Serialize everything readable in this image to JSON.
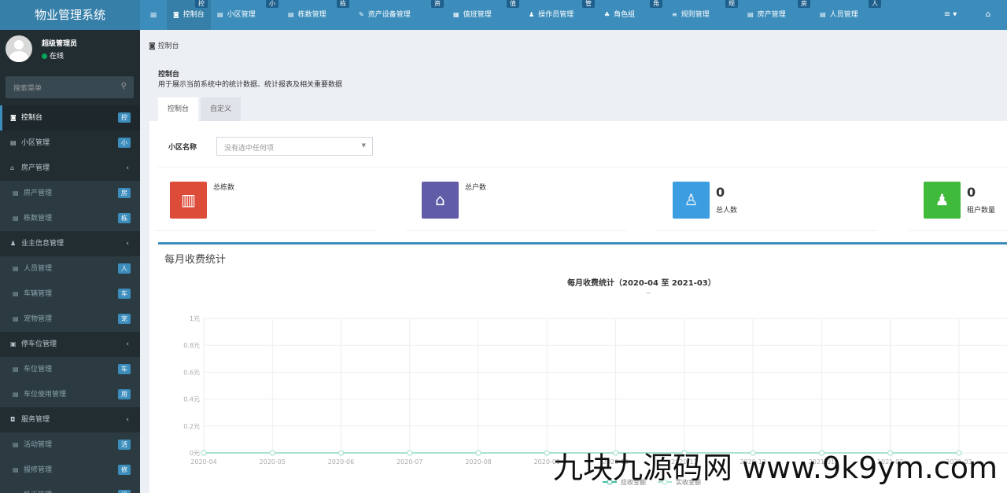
{
  "app_title": "物业管理系统",
  "topnav": {
    "toggle": "≡",
    "items": [
      {
        "label": "控制台",
        "badge": "控",
        "icon": "dashboard-icon"
      },
      {
        "label": "小区管理",
        "badge": "小",
        "icon": "list-icon"
      },
      {
        "label": "栋数管理",
        "badge": "栋",
        "icon": "list-icon"
      },
      {
        "label": "资产设备管理",
        "badge": "资",
        "icon": "wrench-icon"
      },
      {
        "label": "值班管理",
        "badge": "值",
        "icon": "calendar-icon"
      },
      {
        "label": "操作员管理",
        "badge": "管",
        "icon": "user-icon"
      },
      {
        "label": "角色组",
        "badge": "角",
        "icon": "group-icon"
      },
      {
        "label": "规则管理",
        "badge": "规",
        "icon": "bars-icon"
      },
      {
        "label": "房产管理",
        "badge": "房",
        "icon": "list-icon"
      },
      {
        "label": "人员管理",
        "badge": "人",
        "icon": "list-icon"
      }
    ],
    "right_menu": "≡ ▾",
    "home": "⌂"
  },
  "sidebar": {
    "user_name": "超级管理员",
    "user_status": "在线",
    "search_placeholder": "搜索菜单",
    "items": [
      {
        "label": "控制台",
        "badge": "控",
        "type": "top",
        "active": true,
        "icon": "dashboard-icon"
      },
      {
        "label": "小区管理",
        "badge": "小",
        "type": "top",
        "icon": "list-icon"
      },
      {
        "label": "房产管理",
        "arrow": "‹",
        "type": "top",
        "icon": "home-icon"
      },
      {
        "label": "房产管理",
        "badge": "房",
        "type": "sub",
        "icon": "list-icon"
      },
      {
        "label": "栋数管理",
        "badge": "栋",
        "type": "sub",
        "icon": "list-icon"
      },
      {
        "label": "业主信息管理",
        "arrow": "‹",
        "type": "top",
        "icon": "user-icon"
      },
      {
        "label": "人员管理",
        "badge": "人",
        "type": "sub",
        "icon": "list-icon"
      },
      {
        "label": "车辆管理",
        "badge": "车",
        "type": "sub",
        "icon": "list-icon"
      },
      {
        "label": "宠物管理",
        "badge": "宠",
        "type": "sub",
        "icon": "list-icon"
      },
      {
        "label": "停车位管理",
        "arrow": "‹",
        "type": "top",
        "icon": "film-icon"
      },
      {
        "label": "车位管理",
        "badge": "车",
        "type": "sub",
        "icon": "list-icon"
      },
      {
        "label": "车位使用管理",
        "badge": "用",
        "type": "sub",
        "icon": "list-icon"
      },
      {
        "label": "服务管理",
        "arrow": "‹",
        "type": "top",
        "icon": "coffee-icon"
      },
      {
        "label": "活动管理",
        "badge": "活",
        "type": "sub",
        "icon": "list-icon"
      },
      {
        "label": "报修管理",
        "badge": "修",
        "type": "sub",
        "icon": "list-icon"
      },
      {
        "label": "投诉管理",
        "badge": "投",
        "type": "sub",
        "icon": "list-icon"
      }
    ]
  },
  "breadcrumb": "控制台",
  "panel": {
    "title": "控制台",
    "description": "用于展示当前系统中的统计数据、统计报表及相关重要数据",
    "tabs": [
      "控制台",
      "自定义"
    ]
  },
  "filter": {
    "label": "小区名称",
    "placeholder": "没有选中任何项"
  },
  "stats": [
    {
      "label": "总栋数",
      "value": "",
      "color": "#dd4b39",
      "icon": "building-icon"
    },
    {
      "label": "总户数",
      "value": "",
      "color": "#605ca8",
      "icon": "home-icon"
    },
    {
      "label": "总人数",
      "value": "0",
      "color": "#3c9de0",
      "icon": "person-icon"
    },
    {
      "label": "租户数量",
      "value": "0",
      "color": "#3fba3a",
      "icon": "user-icon"
    }
  ],
  "section_title": "每月收费统计",
  "chart_data": {
    "type": "line",
    "title": "每月收费统计（2020-04 至 2021-03）",
    "subtitle": "--",
    "categories": [
      "2020-04",
      "2020-05",
      "2020-06",
      "2020-07",
      "2020-08",
      "2020-09",
      "2020-10",
      "2020-11",
      "2020-12",
      "2021-01",
      "2021-02",
      "2021-03"
    ],
    "y_ticks": [
      "0元",
      "0.2元",
      "0.4元",
      "0.6元",
      "0.8元",
      "1元"
    ],
    "ylim": [
      0,
      1
    ],
    "series": [
      {
        "name": "应收金额",
        "values": [
          0,
          0,
          0,
          0,
          0,
          0,
          0,
          0,
          0,
          0,
          0,
          0
        ],
        "color": "#3fbfa3"
      },
      {
        "name": "实收金额",
        "values": [
          0,
          0,
          0,
          0,
          0,
          0,
          0,
          0,
          0,
          0,
          0,
          0
        ],
        "color": "#a9e3d2"
      }
    ],
    "grid": true,
    "legend": "bottom-center"
  },
  "watermark": "九块九源码网 www.9k9ym.com"
}
